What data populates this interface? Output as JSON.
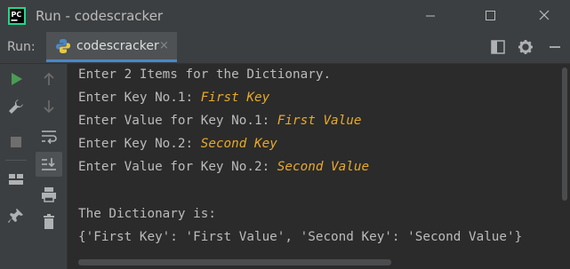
{
  "window": {
    "title": "Run - codescracker"
  },
  "toolwindow": {
    "run_label": "Run:",
    "tab_label": "codescracker",
    "tab_close_glyph": "×"
  },
  "console": {
    "lines": [
      {
        "prompt": "Enter 2 Items for the Dictionary.",
        "input": ""
      },
      {
        "prompt": "Enter Key No.1: ",
        "input": "First Key"
      },
      {
        "prompt": "Enter Value for Key No.1: ",
        "input": "First Value"
      },
      {
        "prompt": "Enter Key No.2: ",
        "input": "Second Key"
      },
      {
        "prompt": "Enter Value for Key No.2: ",
        "input": "Second Value"
      },
      {
        "prompt": "",
        "input": ""
      },
      {
        "prompt": "The Dictionary is:",
        "input": ""
      },
      {
        "prompt": "{'First Key': 'First Value', 'Second Key': 'Second Value'}",
        "input": ""
      }
    ]
  },
  "icons": {
    "titlebar": [
      "pycharm-logo-icon",
      "minimize-icon",
      "maximize-icon",
      "close-icon"
    ],
    "toolwindow": [
      "python-file-icon",
      "layout-icon",
      "gear-icon",
      "hide-icon"
    ],
    "sidebar": [
      "rerun-icon",
      "wrench-icon",
      "stop-icon",
      "layout-icon",
      "pin-icon",
      "scroll-up-icon",
      "scroll-down-icon",
      "soft-wrap-icon",
      "scroll-to-end-icon",
      "print-icon",
      "trash-icon"
    ]
  },
  "colors": {
    "input_text": "#e8a92b",
    "output_text": "#bbbbbb",
    "background": "#2b2b2b",
    "chrome": "#3c3f41",
    "tab_underline": "#4a88c7",
    "run_green": "#499c54"
  }
}
